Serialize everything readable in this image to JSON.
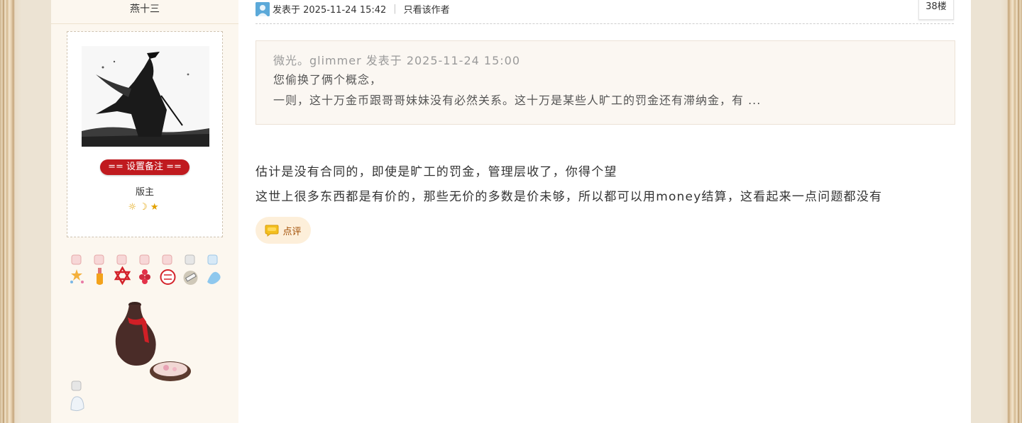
{
  "sidebar": {
    "username": "燕十三",
    "remark_button": "== 设置备注 ==",
    "role": "版主",
    "rank_icons": "☼☽★"
  },
  "post": {
    "posted_at": "发表于 2025-11-24 15:42",
    "only_author": "只看该作者",
    "floor": "38楼",
    "quote": {
      "header": "微光。glimmer 发表于 2025-11-24 15:00",
      "line1": "您偷换了俩个概念，",
      "line2": "一则，这十万金币跟哥哥妹妹没有必然关系。这十万是某些人旷工的罚金还有滞纳金，有 ..."
    },
    "body": [
      "估计是没有合同的，即使是旷工的罚金，管理层收了，你得个望",
      "这世上很多东西都是有价的，那些无价的多数是价未够，所以都可以用money结算，这看起来一点问题都没有"
    ],
    "comment_button": "点评"
  },
  "icons": {
    "user": "user-icon",
    "comment": "comment-bubble-icon",
    "rank": "rank-sun-moon-star-icon"
  },
  "colors": {
    "remark_button_bg": "#c01a1f",
    "sidebar_bg": "#fcf7ef",
    "quote_bg": "#fbf7f2",
    "comment_button_bg": "#fdefda"
  }
}
